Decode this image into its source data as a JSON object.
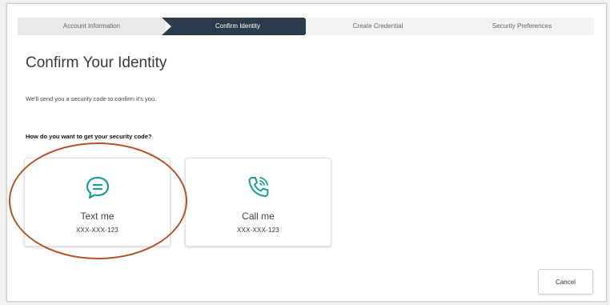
{
  "stepper": {
    "steps": [
      {
        "label": "Account Information",
        "state": "complete"
      },
      {
        "label": "Confirm Identity",
        "state": "active"
      },
      {
        "label": "Create Credential",
        "state": "upcoming"
      },
      {
        "label": "Security Preferences",
        "state": "upcoming"
      }
    ]
  },
  "page": {
    "title": "Confirm Your Identity",
    "subtitle": "We'll send you a security code to confirm it's you.",
    "question": "How do you want to get your security code?"
  },
  "options": [
    {
      "label": "Text me",
      "number": "XXX-XXX-123",
      "icon": "chat-bubble-icon"
    },
    {
      "label": "Call me",
      "number": "XXX-XXX-123",
      "icon": "phone-call-icon"
    }
  ],
  "actions": {
    "cancel_label": "Cancel"
  },
  "colors": {
    "accent": "#1a9e95",
    "active_step": "#2b3c4c",
    "highlight": "#b3532b"
  }
}
